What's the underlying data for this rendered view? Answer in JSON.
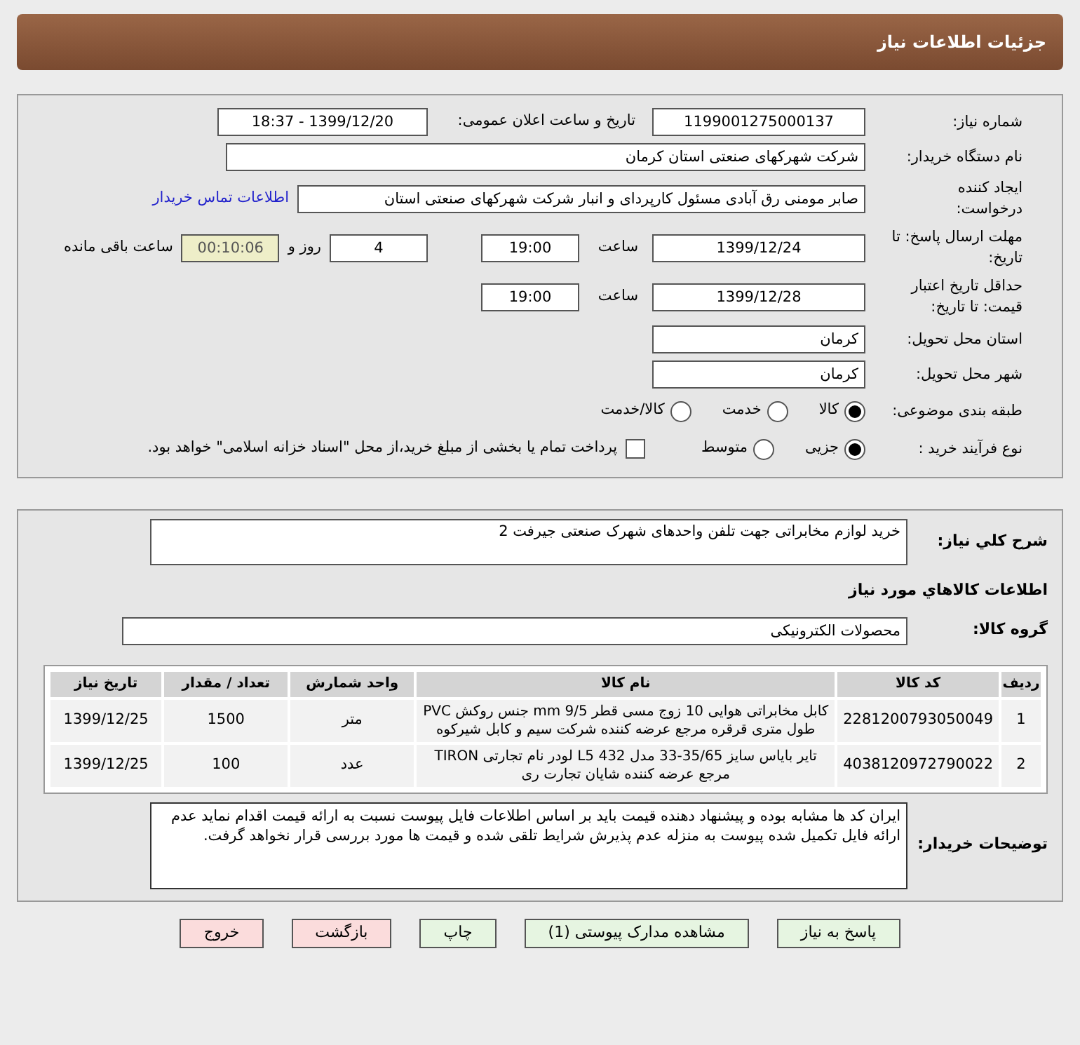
{
  "header": {
    "title": "جزئیات اطلاعات نیاز"
  },
  "need_number": {
    "label": "شماره نیاز:",
    "value": "1199001275000137"
  },
  "announce": {
    "label": "تاریخ و ساعت اعلان عمومی:",
    "value": "1399/12/20 - 18:37"
  },
  "buyer_org": {
    "label": "نام دستگاه خریدار:",
    "value": "شرکت شهرکهای صنعتی استان کرمان"
  },
  "requester": {
    "label": "ایجاد کننده درخواست:",
    "value": "صابر مومنی رق آبادی مسئول کارپردای و انبار شرکت شهرکهای صنعتی استان",
    "link": "اطلاعات تماس خریدار"
  },
  "reply_deadline": {
    "label": "مهلت ارسال پاسخ: تا تاریخ:",
    "date": "1399/12/24",
    "time_label": "ساعت",
    "time": "19:00",
    "days": "4",
    "days_suffix": "روز و",
    "remaining": "00:10:06",
    "remaining_suffix": "ساعت باقی مانده"
  },
  "price_validity": {
    "label": "حداقل تاریخ اعتبار قیمت: تا تاریخ:",
    "date": "1399/12/28",
    "time_label": "ساعت",
    "time": "19:00"
  },
  "province": {
    "label": "استان محل تحویل:",
    "value": "کرمان"
  },
  "city": {
    "label": "شهر محل تحویل:",
    "value": "کرمان"
  },
  "category": {
    "label": "طبقه بندی موضوعی:",
    "options": [
      {
        "label": "کالا",
        "selected": true
      },
      {
        "label": "خدمت",
        "selected": false
      },
      {
        "label": "کالا/خدمت",
        "selected": false
      }
    ]
  },
  "process": {
    "label": "نوع فرآیند خرید :",
    "options": [
      {
        "label": "جزیی",
        "selected": true
      },
      {
        "label": "متوسط",
        "selected": false
      }
    ],
    "treasury": {
      "label": "پرداخت تمام یا بخشی از مبلغ خرید،از محل \"اسناد خزانه اسلامی\" خواهد بود.",
      "checked": false
    }
  },
  "description": {
    "label": "شرح کلي نياز:",
    "value": "خرید لوازم مخابراتی جهت تلفن واحدهای شهرک صنعتی جیرفت 2"
  },
  "goods_heading": "اطلاعات کالاهاي مورد نياز",
  "goods_group": {
    "label": "گروه کالا:",
    "value": "محصولات الکترونیکی"
  },
  "table": {
    "columns": [
      "ردیف",
      "کد کالا",
      "نام کالا",
      "واحد شمارش",
      "تعداد / مقدار",
      "تاریخ نیاز"
    ],
    "rows": [
      [
        "1",
        "2281200793050049",
        "کابل مخابراتی هوایی 10 زوج مسی قطر 9/5 mm جنس روکش PVC طول متری قرقره مرجع عرضه کننده شرکت سیم و کابل شیرکوه",
        "متر",
        "1500",
        "1399/12/25"
      ],
      [
        "2",
        "4038120972790022",
        "تایر بایاس سایز 35/65-33 مدل 432 L5 لودر نام تجارتی TIRON مرجع عرضه کننده شایان تجارت ری",
        "عدد",
        "100",
        "1399/12/25"
      ]
    ]
  },
  "buyer_notes": {
    "label": "توضیحات خریدار:",
    "value": "ایران کد ها مشابه بوده و پیشنهاد دهنده قیمت باید بر اساس اطلاعات فایل پیوست نسبت به ارائه قیمت اقدام نماید عدم ارائه فایل تکمیل شده پیوست به منزله عدم پذیرش شرایط تلقی شده و قیمت ها مورد بررسی قرار نخواهد گرفت."
  },
  "buttons": [
    {
      "label": "پاسخ به نیاز",
      "color": "#e6f5e1"
    },
    {
      "label": "مشاهده مدارک پیوستی (1)",
      "color": "#e6f5e1"
    },
    {
      "label": "چاپ",
      "color": "#e6f5e1"
    },
    {
      "label": "بازگشت",
      "color": "#fbdcdc"
    },
    {
      "label": "خروج",
      "color": "#fbdcdc"
    }
  ]
}
